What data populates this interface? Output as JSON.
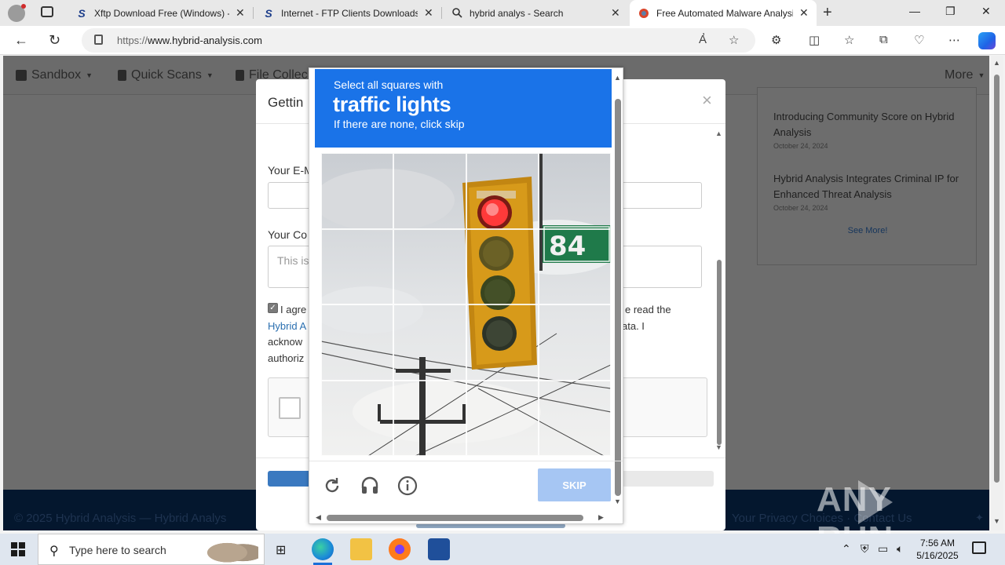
{
  "browser": {
    "tabs": [
      {
        "title": "Xftp Download Free (Windows) -",
        "icon": "s-logo-icon",
        "active": false
      },
      {
        "title": "Internet - FTP Clients Downloads",
        "icon": "s-logo-icon",
        "active": false
      },
      {
        "title": "hybrid analys - Search",
        "icon": "search-icon",
        "active": false
      },
      {
        "title": "Free Automated Malware Analysi",
        "icon": "hybrid-analysis-icon",
        "active": true
      }
    ],
    "url_prefix": "https://",
    "url_host": "www.hybrid-analysis.com"
  },
  "site": {
    "nav": {
      "sandbox": "Sandbox",
      "quick_scans": "Quick Scans",
      "file_collections": "File Collec",
      "more": "More"
    },
    "news": [
      {
        "title": "Introducing Community Score on Hybrid Analysis",
        "date": "October 24, 2024"
      },
      {
        "title": "Hybrid Analysis Integrates Criminal IP for Enhanced Threat Analysis",
        "date": "October 24, 2024"
      }
    ],
    "see_more": "See More!",
    "footer_left": "© 2025 Hybrid Analysis — Hybrid Analys",
    "footer_right": "Your Privacy Choices",
    "footer_contact": "Contact Us"
  },
  "modal": {
    "title": "Gettin",
    "email_label": "Your E-M",
    "comment_label": "Your Co",
    "comment_placeholder": "This is",
    "agree_lines": {
      "l1_left": "I agre",
      "l1_right": "e read the",
      "l2_left": "Hybrid A",
      "l2_right": "ata. I",
      "l3_left": "acknow",
      "l4_left": "authoriz"
    },
    "agree_checked": true
  },
  "captcha": {
    "instruction_top": "Select all squares with",
    "target": "traffic lights",
    "instruction_bottom": "If there are none, click skip",
    "grid": {
      "rows": 4,
      "cols": 4
    },
    "sign_text": "84",
    "skip_label": "SKIP"
  },
  "watermark": {
    "left": "ANY",
    "right": "RUN"
  },
  "taskbar": {
    "search_placeholder": "Type here to search",
    "time": "7:56 AM",
    "date": "5/16/2025"
  }
}
